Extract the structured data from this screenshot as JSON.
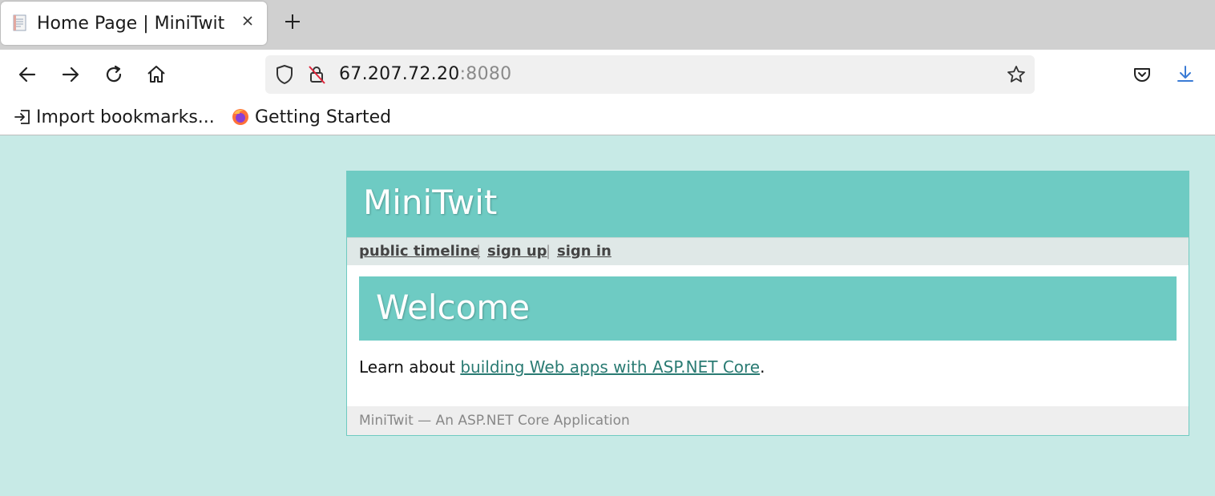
{
  "browser": {
    "tab_title": "Home Page | MiniTwit",
    "url_host": "67.207.72.20",
    "url_port": ":8080",
    "bookmarks": [
      {
        "label": "Import bookmarks..."
      },
      {
        "label": "Getting Started"
      }
    ]
  },
  "site": {
    "title": "MiniTwit",
    "nav": {
      "public_timeline": "public timeline",
      "separator": "|",
      "sign_up": "sign up",
      "sign_in": "sign in"
    },
    "welcome": "Welcome",
    "intro_before": "Learn about ",
    "intro_link": "building Web apps with ASP.NET Core",
    "intro_after": ".",
    "footer": "MiniTwit — An ASP.NET Core Application"
  },
  "colors": {
    "page_bg": "#c7eae6",
    "header_bg": "#6ecbc3",
    "nav_bg": "#dfe8e7",
    "link": "#2a7b73",
    "footer_bg": "#eeeeee"
  }
}
